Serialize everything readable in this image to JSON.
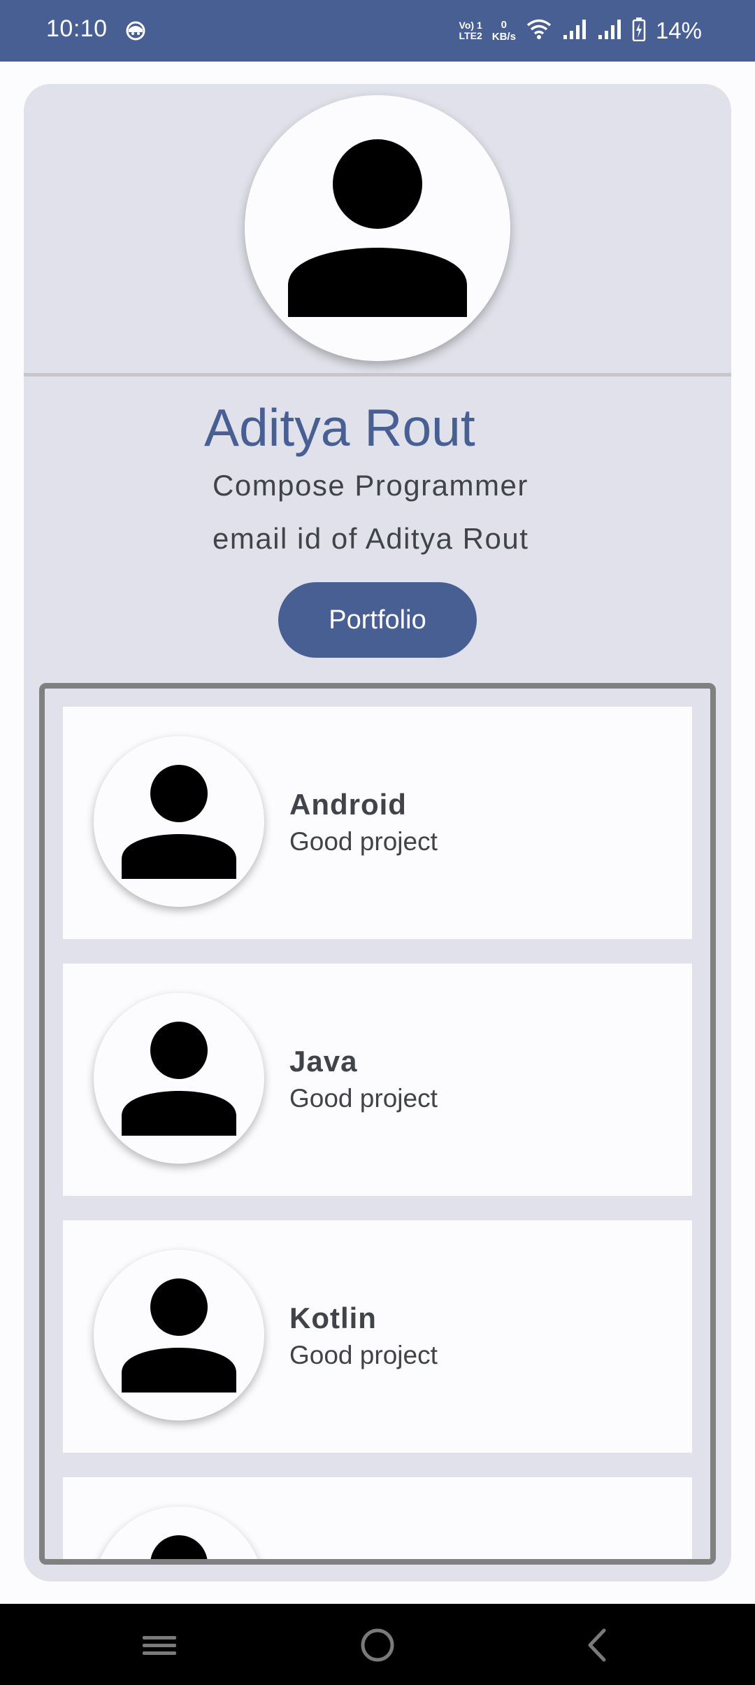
{
  "status_bar": {
    "time": "10:10",
    "volte_line1": "Vo) 1",
    "volte_line2": "LTE2",
    "speed_value": "0",
    "speed_unit": "KB/s",
    "battery_percent": "14%",
    "icons": [
      "app-notification-icon",
      "wifi-icon",
      "signal-icon",
      "signal-icon",
      "battery-charging-icon"
    ]
  },
  "profile": {
    "avatar_icon": "person-icon",
    "name": "Aditya Rout",
    "role": "Compose Programmer",
    "email": "email id of Aditya Rout",
    "portfolio_label": "Portfolio"
  },
  "projects": [
    {
      "title": "Android",
      "description": "Good project",
      "icon": "person-icon"
    },
    {
      "title": "Java",
      "description": "Good project",
      "icon": "person-icon"
    },
    {
      "title": "Kotlin",
      "description": "Good project",
      "icon": "person-icon"
    },
    {
      "title": "",
      "description": "",
      "icon": "person-icon"
    }
  ],
  "nav_bar": {
    "icons": [
      "menu-icon",
      "home-icon",
      "back-icon"
    ]
  },
  "colors": {
    "primary": "#485f93",
    "surface": "#e0e1ea",
    "background": "#fcfbfd",
    "text": "#404349",
    "outline": "#808080"
  }
}
